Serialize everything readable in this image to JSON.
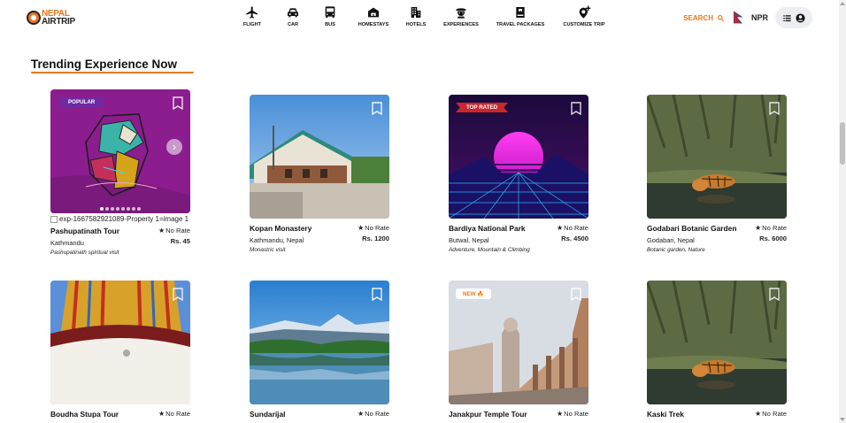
{
  "brand": {
    "line1": "NEPAL",
    "line2": "AIRTRIP"
  },
  "nav": {
    "items": [
      {
        "label": "FLIGHT",
        "icon": "plane-icon"
      },
      {
        "label": "CAR",
        "icon": "car-icon"
      },
      {
        "label": "BUS",
        "icon": "bus-icon"
      },
      {
        "label": "HOMESTAYS",
        "icon": "house-icon"
      },
      {
        "label": "HOTELS",
        "icon": "building-icon"
      },
      {
        "label": "EXPERIENCES",
        "icon": "explorer-icon"
      },
      {
        "label": "TRAVEL PACKAGES",
        "icon": "package-icon"
      },
      {
        "label": "CUSTOMIZE TRIP",
        "icon": "map-pin-plus-icon"
      }
    ]
  },
  "header": {
    "search_label": "SEARCH",
    "currency": "NPR"
  },
  "section": {
    "title": "Trending Experience Now"
  },
  "cards": [
    {
      "name": "Pashupatinath Tour",
      "rating": "No Rate",
      "location": "Kathmandu",
      "price": "Rs. 45",
      "tags": "Pashupatinath spiritual visit",
      "badge": "POPULAR",
      "alt": "exp-1667582921089-Property 1=image 1"
    },
    {
      "name": "Kopan Monastery",
      "rating": "No Rate",
      "location": "Kathmandu, Nepal",
      "price": "Rs. 1200",
      "tags": "Monastric visit"
    },
    {
      "name": "Bardiya National Park",
      "rating": "No Rate",
      "location": "Butwal, Nepal",
      "price": "Rs. 4500",
      "tags": "Adventure, Mountain & Climbing",
      "badge": "TOP RATED"
    },
    {
      "name": "Godabari Botanic Garden",
      "rating": "No Rate",
      "location": "Godabari, Nepal",
      "price": "Rs. 6000",
      "tags": "Botanic garden, Nature"
    },
    {
      "name": "Boudha Stupa Tour",
      "rating": "No Rate"
    },
    {
      "name": "Sundarijal",
      "rating": "No Rate"
    },
    {
      "name": "Janakpur Temple Tour",
      "rating": "No Rate",
      "badge": "NEW 🔥"
    },
    {
      "name": "Kaski Trek",
      "rating": "No Rate"
    }
  ],
  "colors": {
    "accent": "#e87722",
    "popular": "#6e2aa3",
    "toprated": "#c8272c"
  }
}
